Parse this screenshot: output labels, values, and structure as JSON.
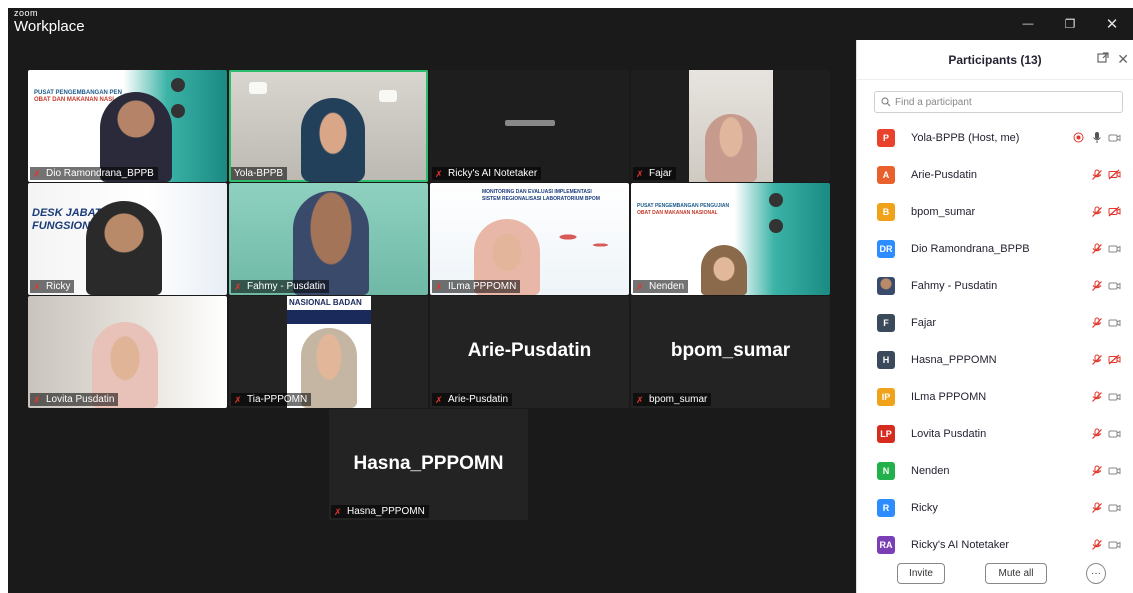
{
  "app": {
    "logo_line1": "zoom",
    "logo_line2": "Workplace"
  },
  "window_controls": {
    "minimize": "—",
    "restore": "❐",
    "close": "✕"
  },
  "gallery": {
    "tiles": [
      {
        "name": "Dio Ramondrana_BPPB",
        "muted": true,
        "video": true,
        "bg": "slide-teal",
        "active": false
      },
      {
        "name": "Yola-BPPB",
        "muted": false,
        "video": true,
        "bg": "office",
        "active": true
      },
      {
        "name": "Ricky's AI Notetaker",
        "muted": true,
        "video": true,
        "bg": "dark",
        "active": false
      },
      {
        "name": "Fajar",
        "muted": true,
        "video": true,
        "bg": "photo",
        "active": false
      },
      {
        "name": "Ricky",
        "muted": true,
        "video": true,
        "bg": "slide-blue",
        "active": false
      },
      {
        "name": "Fahmy - Pusdatin",
        "muted": true,
        "video": true,
        "bg": "green-room",
        "active": false
      },
      {
        "name": "ILma PPPOMN",
        "muted": true,
        "video": true,
        "bg": "map-slide",
        "active": false
      },
      {
        "name": "Nenden",
        "muted": true,
        "video": true,
        "bg": "slide-teal2",
        "active": false
      },
      {
        "name": "Lovita Pusdatin",
        "muted": true,
        "video": true,
        "bg": "room",
        "active": false
      },
      {
        "name": "Tia-PPPOMN",
        "muted": true,
        "video": true,
        "bg": "portrait",
        "active": false
      },
      {
        "name": "Arie-Pusdatin",
        "muted": true,
        "video": false,
        "bg": "none",
        "active": false
      },
      {
        "name": "bpom_sumar",
        "muted": true,
        "video": false,
        "bg": "none",
        "active": false
      },
      {
        "name": "Hasna_PPPOMN",
        "muted": true,
        "video": false,
        "bg": "none",
        "active": false
      }
    ],
    "slide_texts": {
      "dio_header": "PUSAT PENGEMBANGAN PEN",
      "dio_sub": "OBAT DAN MAKANAN NASI",
      "ricky_desk": "DESK JABAT",
      "ricky_desk2": "FUNGSION",
      "ilma_title": "MONITORING DAN EVALUASI IMPLEMENTASI",
      "ilma_title2": "SISTEM REGIONALISASI LABORATORIUM BPOM",
      "nenden_header": "PUSAT PENGEMBANGAN PENGUJIAN",
      "nenden_sub": "OBAT DAN MAKANAN NASIONAL",
      "tia_banner": "NASIONAL BADAN"
    }
  },
  "participants_panel": {
    "title": "Participants (13)",
    "search_placeholder": "Find a participant",
    "list": [
      {
        "name": "Yola-BPPB (Host, me)",
        "initials": "P",
        "color": "#e8412c",
        "mic": "on",
        "cam": "off",
        "recording": true
      },
      {
        "name": "Arie-Pusdatin",
        "initials": "A",
        "color": "#e8612c",
        "mic": "muted",
        "cam": "off-red"
      },
      {
        "name": "bpom_sumar",
        "initials": "B",
        "color": "#f0a21a",
        "mic": "muted",
        "cam": "off-red"
      },
      {
        "name": "Dio Ramondrana_BPPB",
        "initials": "DR",
        "color": "#2d8cff",
        "mic": "muted",
        "cam": "on"
      },
      {
        "name": "Fahmy - Pusdatin",
        "initials": "",
        "color": "#8a6a4a",
        "mic": "muted",
        "cam": "on",
        "photo": true
      },
      {
        "name": "Fajar",
        "initials": "F",
        "color": "#3b4a5a",
        "mic": "muted",
        "cam": "on"
      },
      {
        "name": "Hasna_PPPOMN",
        "initials": "H",
        "color": "#3b4a5a",
        "mic": "muted",
        "cam": "off-red"
      },
      {
        "name": "ILma PPPOMN",
        "initials": "IP",
        "color": "#f0a21a",
        "mic": "muted",
        "cam": "on"
      },
      {
        "name": "Lovita Pusdatin",
        "initials": "LP",
        "color": "#d62b1f",
        "mic": "muted",
        "cam": "on"
      },
      {
        "name": "Nenden",
        "initials": "N",
        "color": "#22b04b",
        "mic": "muted",
        "cam": "on"
      },
      {
        "name": "Ricky",
        "initials": "R",
        "color": "#2d8cff",
        "mic": "muted",
        "cam": "on"
      },
      {
        "name": "Ricky's AI Notetaker",
        "initials": "RA",
        "color": "#7b3fb5",
        "mic": "muted",
        "cam": "on"
      }
    ],
    "footer": {
      "invite": "Invite",
      "mute_all": "Mute all",
      "more": "···"
    }
  },
  "colors": {
    "active_speaker": "#2dbd6e",
    "muted_red": "#e0362c",
    "window_bg": "#1a1a1a"
  }
}
